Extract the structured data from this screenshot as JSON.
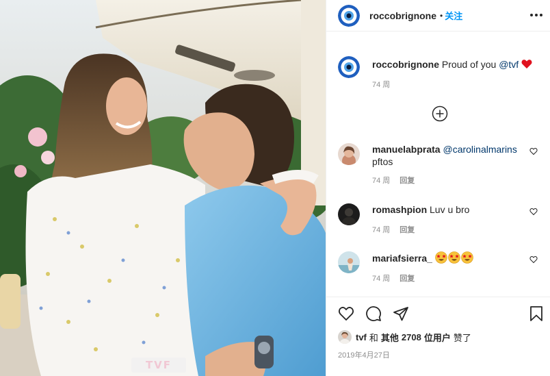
{
  "header": {
    "username": "roccobrignone",
    "separator": "•",
    "follow_label": "关注",
    "more_icon": "more-horizontal-icon"
  },
  "photo": {
    "watermark": "TVF",
    "description_icon": "post-photo"
  },
  "caption": {
    "username": "roccobrignone",
    "text": "Proud of you",
    "mention": "@tvf",
    "emoji": "red-heart",
    "time": "74 周"
  },
  "load_more_icon": "plus-circle-icon",
  "comments": [
    {
      "username": "manuelabprata",
      "mention": "@carolinalmarins",
      "text": "pftos",
      "time": "74 周",
      "reply": "回复"
    },
    {
      "username": "romashpion",
      "mention": "",
      "text": "Luv u bro",
      "time": "74 周",
      "reply": "回复"
    },
    {
      "username": "mariafsierra_",
      "mention": "",
      "text": "",
      "emojis": [
        "star-struck",
        "star-struck",
        "star-struck"
      ],
      "time": "74 周",
      "reply": "回复"
    }
  ],
  "actions": {
    "like_icon": "heart-icon",
    "comment_icon": "comment-icon",
    "share_icon": "send-icon",
    "save_icon": "bookmark-icon"
  },
  "likes": {
    "user": "tvf",
    "and": "和",
    "others_prefix": "其他",
    "count": "2708",
    "others_suffix": "位用户",
    "liked": "赞了"
  },
  "date": "2019年4月27日",
  "colors": {
    "follow": "#0095f6",
    "mention": "#00376b",
    "meta": "#8e8e8e",
    "eye_blue": "#1f5fbf"
  }
}
